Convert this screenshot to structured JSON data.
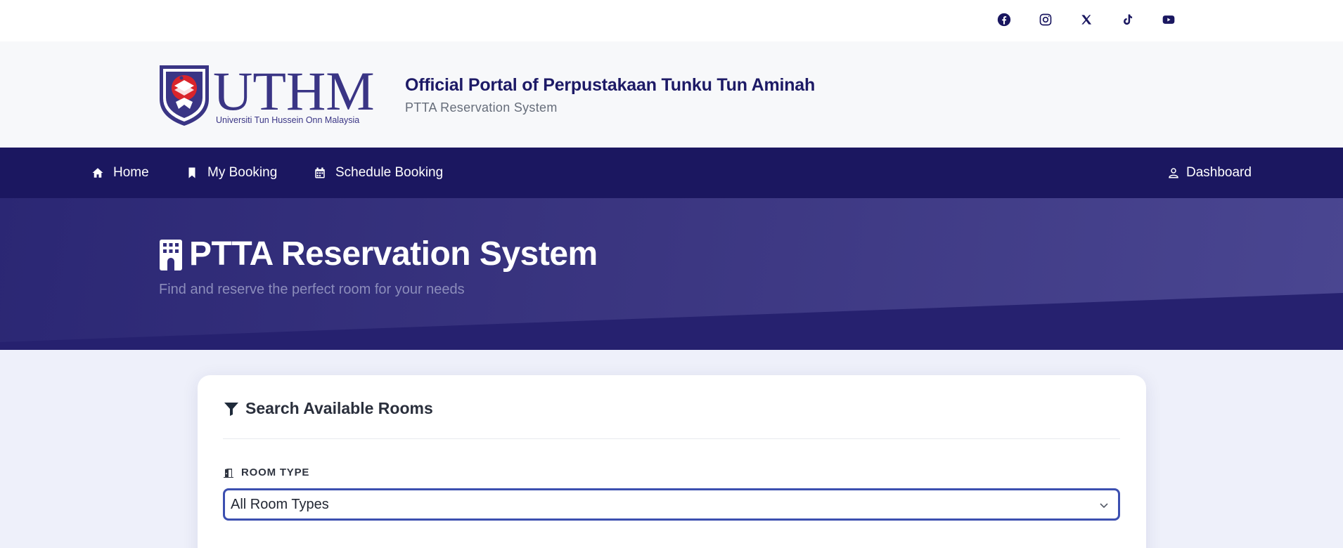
{
  "social": {
    "items": [
      {
        "name": "facebook-icon"
      },
      {
        "name": "instagram-icon"
      },
      {
        "name": "x-icon"
      },
      {
        "name": "tiktok-icon"
      },
      {
        "name": "youtube-icon"
      }
    ]
  },
  "brand": {
    "logo_text": "UTHM",
    "logo_subtext": "Universiti Tun Hussein Onn Malaysia",
    "title": "Official Portal of Perpustakaan Tunku Tun Aminah",
    "subtitle": "PTTA Reservation System"
  },
  "nav": {
    "home": "Home",
    "my_booking": "My Booking",
    "schedule_booking": "Schedule Booking",
    "dashboard": "Dashboard"
  },
  "hero": {
    "title": "PTTA Reservation System",
    "subtitle": "Find and reserve the perfect room for your needs"
  },
  "search": {
    "heading": "Search Available Rooms",
    "room_type_label": "ROOM TYPE",
    "room_type_value": "All Room Types"
  },
  "colors": {
    "nav_bg": "#1b1760",
    "brand_text": "#1d1a66",
    "hero_bg": "#2b2774",
    "select_border": "#3c4fb0"
  }
}
